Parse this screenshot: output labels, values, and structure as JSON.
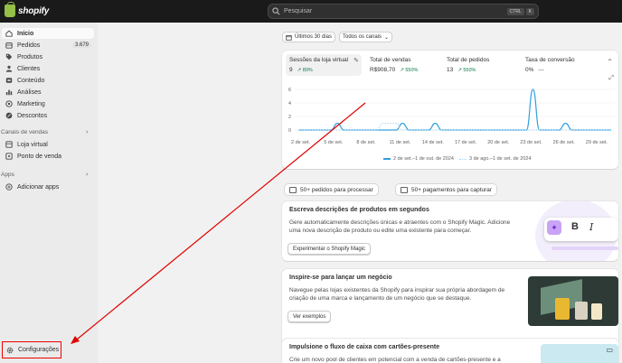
{
  "topbar": {
    "logo_text": "shopify",
    "search_placeholder": "Pesquisar",
    "shortcut_key1": "CTRL",
    "shortcut_key2": "K"
  },
  "sidebar": {
    "items": [
      {
        "label": "Início",
        "icon": "home-icon",
        "active": true
      },
      {
        "label": "Pedidos",
        "icon": "orders-icon",
        "badge": "3.679"
      },
      {
        "label": "Produtos",
        "icon": "tag-icon"
      },
      {
        "label": "Clientes",
        "icon": "person-icon"
      },
      {
        "label": "Conteúdo",
        "icon": "content-icon"
      },
      {
        "label": "Análises",
        "icon": "analytics-icon"
      },
      {
        "label": "Marketing",
        "icon": "target-icon"
      },
      {
        "label": "Descontos",
        "icon": "discount-icon"
      }
    ],
    "sales_channels_label": "Canais de vendas",
    "sales_channels": [
      {
        "label": "Loja virtual",
        "icon": "store-icon"
      },
      {
        "label": "Ponto de venda",
        "icon": "pos-icon"
      }
    ],
    "apps_label": "Apps",
    "add_apps_label": "Adicionar apps",
    "settings_label": "Configurações"
  },
  "filters": {
    "date_range": "Últimos 30 dias",
    "channels": "Todos os canais"
  },
  "metrics": [
    {
      "title": "Sessões da loja virtual",
      "value": "9",
      "trend": "80%"
    },
    {
      "title": "Total de vendas",
      "value": "R$908,70",
      "trend": "550%"
    },
    {
      "title": "Total de pedidos",
      "value": "13",
      "trend": "550%"
    },
    {
      "title": "Taxa de conversão",
      "value": "0%",
      "trend": "—"
    }
  ],
  "chart_data": {
    "type": "line",
    "ylim": [
      0,
      6
    ],
    "yticks": [
      "6",
      "4",
      "2",
      "0"
    ],
    "xticks": [
      "2 de set.",
      "5 de set.",
      "8 de set.",
      "11 de set.",
      "14 de set.",
      "17 de set.",
      "20 de set.",
      "23 de set.",
      "26 de set.",
      "29 de set."
    ],
    "series": [
      {
        "name": "2 de set.–1 de out. de 2024",
        "color": "#33a0e0",
        "values": [
          0,
          0,
          0,
          0,
          0,
          0,
          1,
          0,
          0,
          0,
          0,
          0,
          0,
          0,
          0,
          0,
          1,
          0,
          0,
          0,
          0,
          1,
          0,
          0,
          0,
          0,
          0,
          0,
          0,
          0,
          0,
          0,
          0,
          0,
          0,
          0,
          6,
          0,
          0,
          0,
          0,
          1,
          0,
          0,
          0,
          0,
          0,
          0,
          0
        ]
      },
      {
        "name": "3 de ago.–1 de set. de 2024",
        "color": "#a8d4ef",
        "values": [
          0,
          0,
          0,
          0,
          0,
          0,
          0,
          0,
          0,
          0,
          0,
          0,
          0,
          1,
          1,
          1,
          0,
          0,
          0,
          0,
          0,
          0,
          0,
          0,
          0,
          0,
          0,
          0,
          0,
          0,
          0,
          0,
          0,
          0,
          0,
          0,
          0,
          0,
          0,
          0,
          0,
          0,
          0,
          0,
          0,
          0,
          0,
          0,
          0
        ]
      }
    ]
  },
  "action_pills": [
    {
      "label": "50+ pedidos para processar"
    },
    {
      "label": "50+ pagamentos para capturar"
    }
  ],
  "cards": [
    {
      "title": "Escreva descrições de produtos em segundos",
      "desc": "Gere automaticamente descrições únicas e atraentes com o Shopify Magic. Adicione uma nova descrição de produto ou edite uma existente para começar.",
      "button": "Experimentar o Shopify Magic"
    },
    {
      "title": "Inspire-se para lançar um negócio",
      "desc": "Navegue pelas lojas existentes da Shopify para inspirar sua própria abordagem de criação de uma marca e lançamento de um negócio que se destaque.",
      "button": "Ver exemplos"
    },
    {
      "title": "Impulsione o fluxo de caixa com cartões-presente",
      "desc": "Crie um novo pool de clientes em potencial com a venda de cartões-presente e a",
      "button": ""
    }
  ],
  "colors": {
    "accent": "#e00000",
    "trend": "#0a7c4a",
    "line": "#33a0e0"
  }
}
